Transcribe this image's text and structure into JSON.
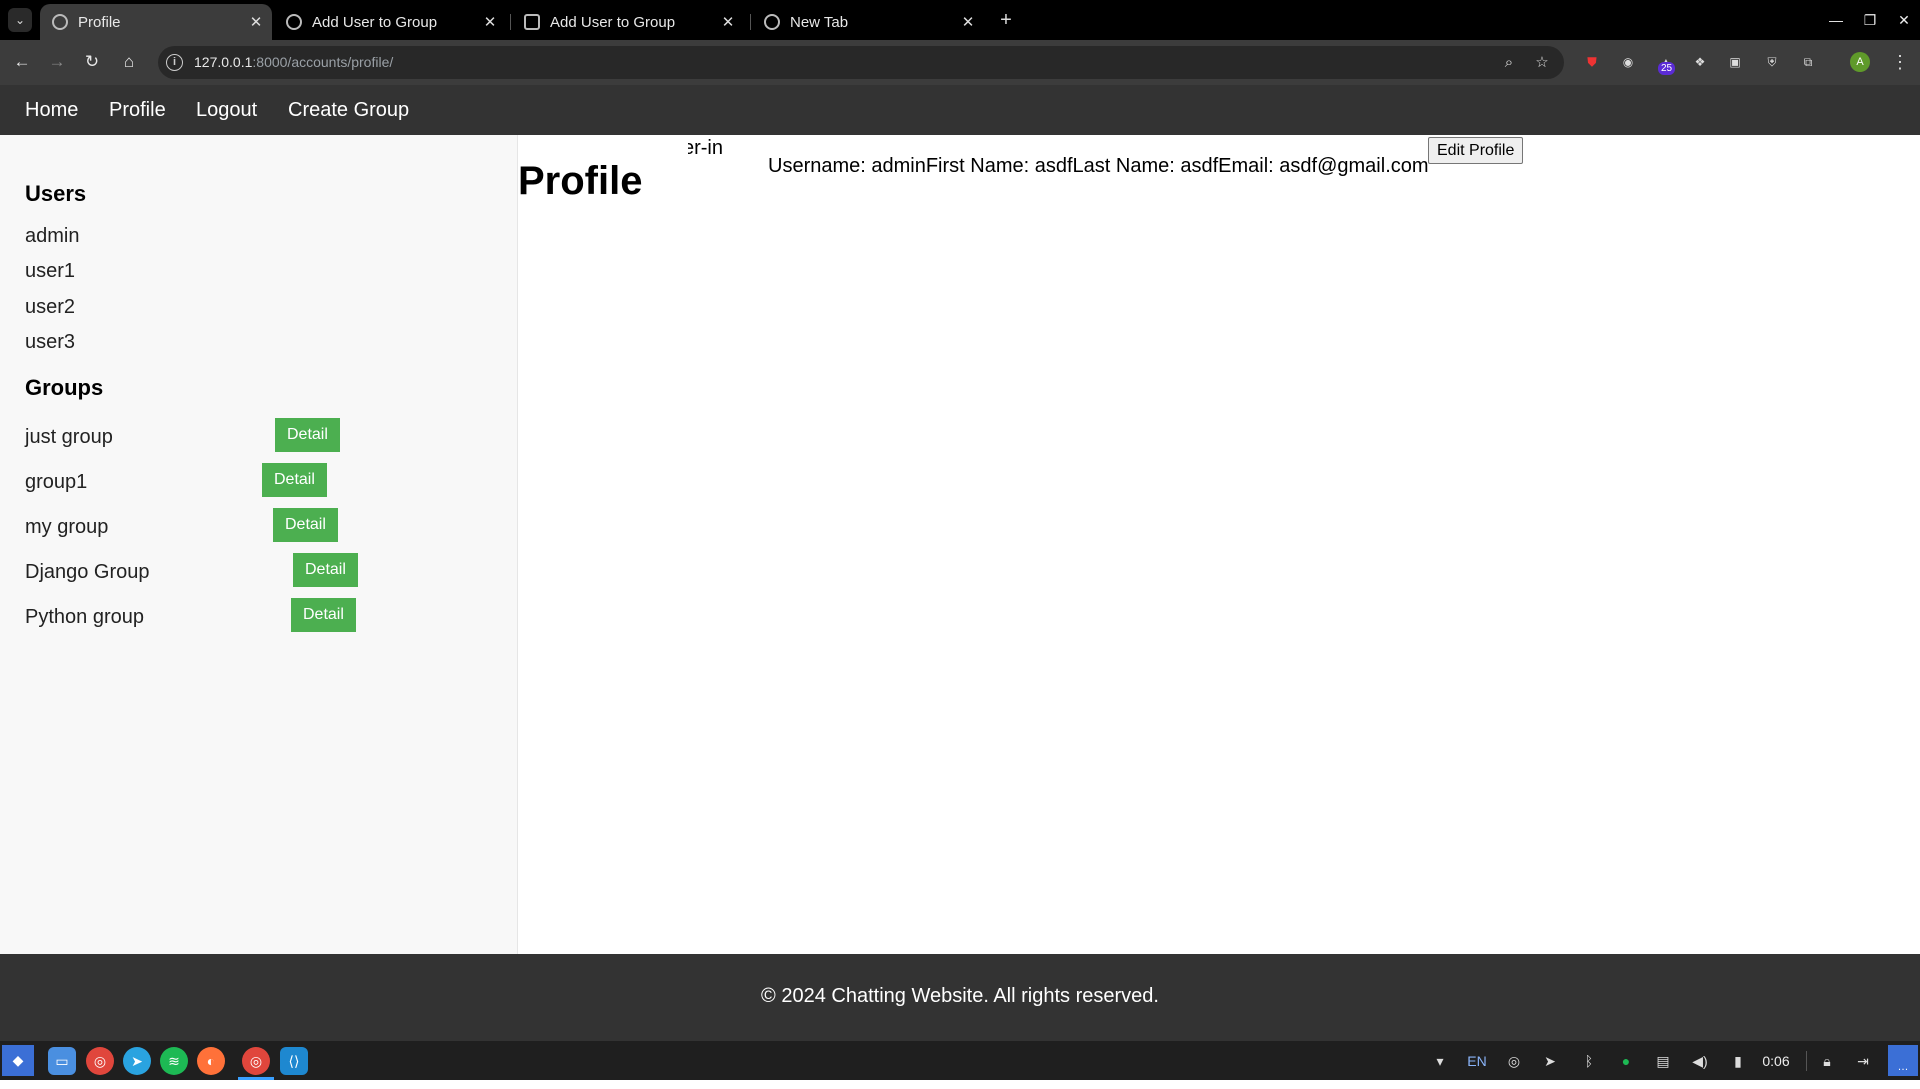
{
  "browser": {
    "tabs": [
      {
        "title": "Profile",
        "active": true
      },
      {
        "title": "Add User to Group",
        "active": false
      },
      {
        "title": "Add User to Group",
        "active": false
      },
      {
        "title": "New Tab",
        "active": false
      }
    ],
    "url_host": "127.0.0.1",
    "url_path": ":8000/accounts/profile/",
    "extension_badge": "25",
    "profile_initial": "A"
  },
  "nav": {
    "home": "Home",
    "profile": "Profile",
    "logout": "Logout",
    "create_group": "Create Group"
  },
  "sidebar": {
    "users_heading": "Users",
    "users": [
      "admin",
      "user1",
      "user2",
      "user3"
    ],
    "groups_heading": "Groups",
    "groups": [
      "just group",
      "group1",
      "my group",
      "Django Group",
      "Python group"
    ],
    "detail_label": "Detail"
  },
  "main": {
    "clipped_text": "er-in",
    "title": "Profile",
    "info": "Username: adminFirst Name: asdfLast Name: asdfEmail: asdf@gmail.com",
    "edit_button": "Edit Profile"
  },
  "footer": {
    "text": "© 2024 Chatting Website. All rights reserved."
  },
  "taskbar": {
    "language": "EN",
    "clock": "0:06"
  },
  "colors": {
    "nav_bg": "#333333",
    "detail_button": "#4caf50",
    "sidebar_bg": "#f8f8f8"
  }
}
